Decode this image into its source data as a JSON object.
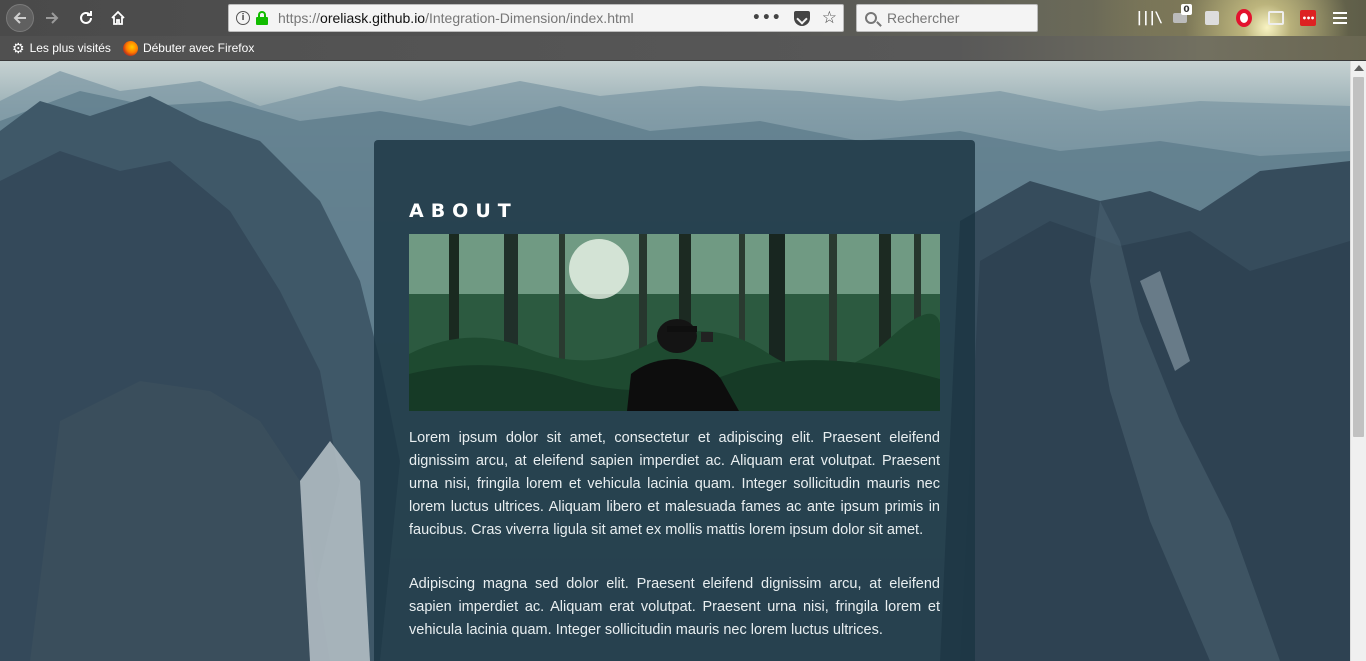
{
  "browser": {
    "url_prefix": "https://",
    "url_host": "oreliask.github.io",
    "url_path": "/Integration-Dimension/index.html",
    "search_placeholder": "Rechercher",
    "notification_badge": "0",
    "bookmarks": [
      {
        "label": "Les plus visités",
        "icon": "gear-icon"
      },
      {
        "label": "Débuter avec Firefox",
        "icon": "firefox-icon"
      }
    ]
  },
  "page": {
    "title": "ABOUT",
    "paragraphs": [
      "Lorem ipsum dolor sit amet, consectetur et adipiscing elit. Praesent eleifend dignissim arcu, at eleifend sapien imperdiet ac. Aliquam erat volutpat. Praesent urna nisi, fringila lorem et vehicula lacinia quam. Integer sollicitudin mauris nec lorem luctus ultrices. Aliquam libero et malesuada fames ac ante ipsum primis in faucibus. Cras viverra ligula sit amet ex mollis mattis lorem ipsum dolor sit amet.",
      "Adipiscing magna sed dolor elit. Praesent eleifend dignissim arcu, at eleifend sapien imperdiet ac. Aliquam erat volutpat. Praesent urna nisi, fringila lorem et vehicula lacinia quam. Integer sollicitudin mauris nec lorem luctus ultrices."
    ]
  },
  "colors": {
    "panel_bg": "#1b3442",
    "lock_green": "#12bc00"
  }
}
